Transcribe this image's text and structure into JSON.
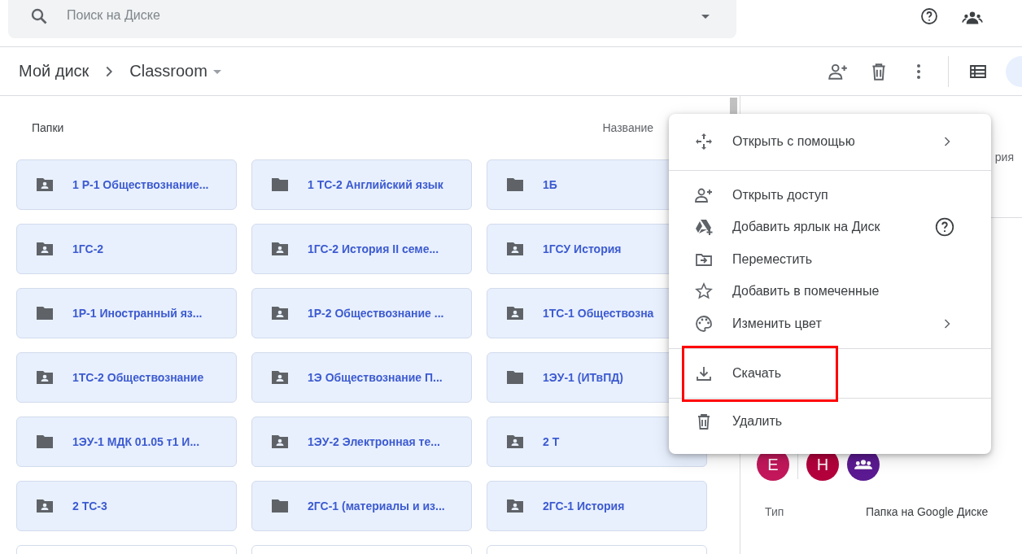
{
  "search": {
    "placeholder": "Поиск на Диске"
  },
  "breadcrumb": [
    {
      "label": "Мой диск"
    },
    {
      "label": "Classroom"
    }
  ],
  "section_title": "Папки",
  "sort_label": "Название",
  "folders": [
    {
      "name": "1 Р-1 Обществознание...",
      "shared": true
    },
    {
      "name": "1 ТС-2 Английский язык",
      "shared": false
    },
    {
      "name": "1Б",
      "shared": false
    },
    {
      "name": "1ГС-2",
      "shared": true
    },
    {
      "name": "1ГС-2 История II семе...",
      "shared": true
    },
    {
      "name": "1ГСУ История",
      "shared": true
    },
    {
      "name": "1Р-1 Иностранный яз...",
      "shared": false
    },
    {
      "name": "1Р-2 Обществознание ...",
      "shared": true
    },
    {
      "name": "1ТС-1 Обществозна",
      "shared": true
    },
    {
      "name": "1ТС-2 Обществознание",
      "shared": true
    },
    {
      "name": "1Э Обществознание П...",
      "shared": true
    },
    {
      "name": "1ЭУ-1 (ИТвПД)",
      "shared": false
    },
    {
      "name": "1ЭУ-1 МДК 01.05 т1 И...",
      "shared": false
    },
    {
      "name": "1ЭУ-2 Электронная те...",
      "shared": true
    },
    {
      "name": "2 Т",
      "shared": true
    },
    {
      "name": "2 ТС-3",
      "shared": true
    },
    {
      "name": "2ГС-1 (материалы и из...",
      "shared": false
    },
    {
      "name": "2ГС-1 История",
      "shared": true
    }
  ],
  "details": {
    "title_fragment": "рия",
    "access": [
      {
        "kind": "person",
        "initial": "E",
        "color": "#c2185b"
      },
      {
        "kind": "person",
        "initial": "H",
        "color": "#b3003c"
      },
      {
        "kind": "group",
        "color": "#5b1a91"
      }
    ],
    "properties": [
      {
        "label": "Тип",
        "value": "Папка на Google Диске"
      }
    ]
  },
  "menu": {
    "groups": [
      {
        "items": [
          {
            "kind": "open-with",
            "label": "Открыть с помощью",
            "submenu": true
          }
        ]
      },
      {
        "items": [
          {
            "kind": "share",
            "label": "Открыть доступ",
            "submenu": false
          },
          {
            "kind": "shortcut",
            "label": "Добавить ярлык на Диск",
            "submenu": false,
            "help": true
          },
          {
            "kind": "move",
            "label": "Переместить",
            "submenu": false
          },
          {
            "kind": "star",
            "label": "Добавить в помеченные",
            "submenu": false
          },
          {
            "kind": "palette",
            "label": "Изменить цвет",
            "submenu": true
          }
        ]
      },
      {
        "items": [
          {
            "kind": "download",
            "label": "Скачать",
            "submenu": false,
            "highlighted": true
          }
        ]
      },
      {
        "items": [
          {
            "kind": "trash",
            "label": "Удалить",
            "submenu": false
          }
        ]
      }
    ]
  }
}
